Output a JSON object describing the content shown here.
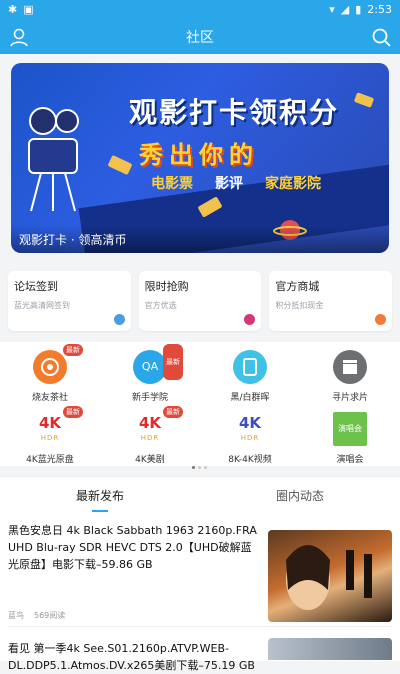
{
  "status_bar": {
    "time": "2:53"
  },
  "header": {
    "title": "社区"
  },
  "banner": {
    "headline": "观影打卡领积分",
    "subhead": "秀出你的",
    "tags": [
      "电影票",
      "影评",
      "家庭影院"
    ],
    "caption": "观影打卡 · 领高清币"
  },
  "cards": [
    {
      "title": "论坛签到",
      "subtitle": "蓝光高清网签到",
      "dot_color": "#4a9de0"
    },
    {
      "title": "限时抢购",
      "subtitle": "官方优选",
      "dot_color": "#d6357a"
    },
    {
      "title": "官方商城",
      "subtitle": "积分抵扣现金",
      "dot_color": "#f07b3a"
    }
  ],
  "grid": [
    {
      "label": "烧友茶社",
      "badge": "最新",
      "color": "#f47b2b",
      "glyph": "◉"
    },
    {
      "label": "新手学院",
      "badge": "最新",
      "color": "#2aa7e8",
      "glyph": "QA"
    },
    {
      "label": "黑/白群晖",
      "badge": "",
      "color": "#3fc2e6",
      "glyph": "▢"
    },
    {
      "label": "寻片求片",
      "badge": "",
      "color": "#6d6f73",
      "glyph": "▶"
    },
    {
      "label": "4K蓝光原盘",
      "badge": "最新",
      "color": "#ffffff",
      "glyph": "4K"
    },
    {
      "label": "4K美剧",
      "badge": "最新",
      "color": "#ffffff",
      "glyph": "4K"
    },
    {
      "label": "8K-4K视频",
      "badge": "",
      "color": "#ffffff",
      "glyph": "4K"
    },
    {
      "label": "演唱会",
      "badge": "",
      "color": "#6cc24a",
      "glyph": "演唱会"
    }
  ],
  "tabs": [
    {
      "label": "最新发布"
    },
    {
      "label": "圈内动态"
    }
  ],
  "feed": [
    {
      "title": "黑色安息日 4k Black Sabbath 1963 2160p.FRA UHD Blu-ray SDR HEVC DTS 2.0【UHD破解蓝光原盘】电影下载–59.86 GB",
      "author": "蓝鸟",
      "views": "569阅读"
    },
    {
      "title": "看见 第一季4k See.S01.2160p.ATVP.WEB-DL.DDP5.1.Atmos.DV.x265美剧下载–75.19 GB",
      "author": "",
      "views": ""
    }
  ]
}
